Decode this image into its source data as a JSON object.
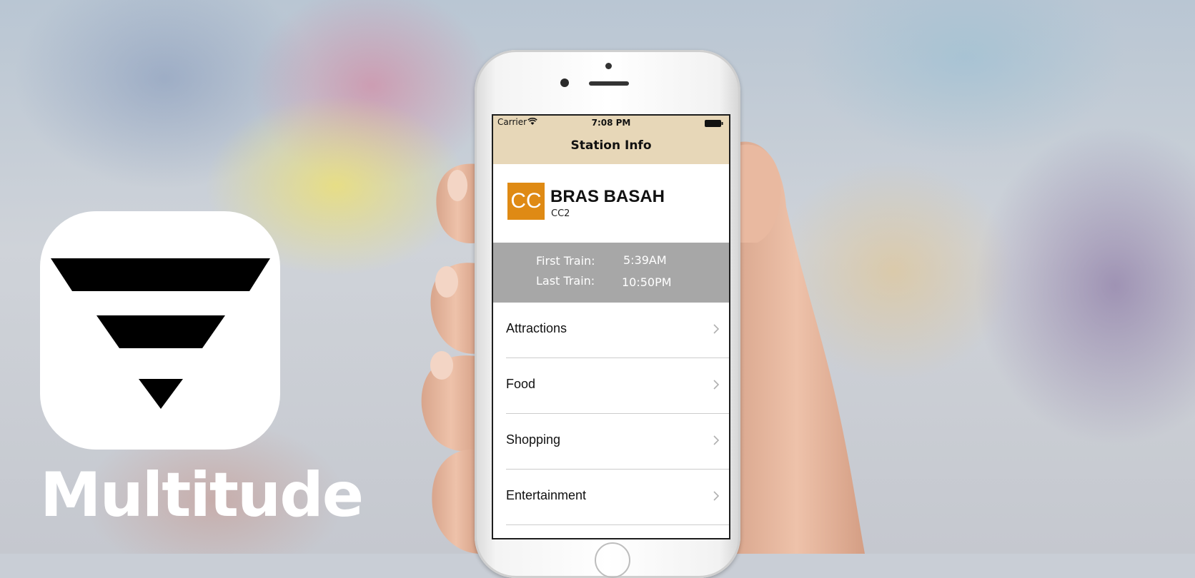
{
  "app": {
    "name": "Multitude"
  },
  "status_bar": {
    "carrier": "Carrier",
    "time": "7:08 PM"
  },
  "nav": {
    "title": "Station Info"
  },
  "station": {
    "line_code": "CC",
    "name": "BRAS BASAH",
    "code": "CC2",
    "line_color": "#df8a14"
  },
  "train_times": {
    "first_label": "First Train:",
    "first_value": "5:39AM",
    "last_label": "Last Train:",
    "last_value": "10:50PM"
  },
  "menu": {
    "items": [
      {
        "label": "Attractions",
        "icon": "chevron-right-icon"
      },
      {
        "label": "Food",
        "icon": "chevron-right-icon"
      },
      {
        "label": "Shopping",
        "icon": "chevron-right-icon"
      },
      {
        "label": "Entertainment",
        "icon": "chevron-right-icon"
      }
    ]
  },
  "colors": {
    "nav_background": "#e7d7b8",
    "times_background": "#a7a7a7"
  }
}
